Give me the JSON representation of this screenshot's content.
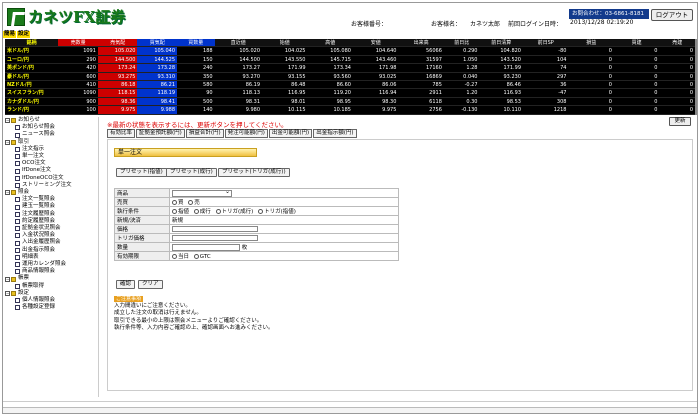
{
  "header": {
    "logo_text": "カネツFX証券",
    "customer_no_label": "お客様番号：",
    "customer_name_label": "お客様名：",
    "customer_name": "カネツ太郎",
    "last_login_label": "前回ログイン日時：",
    "last_login": "2013/12/28 02:19:20",
    "contact": "お問合わせ：03-6861-8181",
    "logout": "ログアウト"
  },
  "small_tabs": [
    "簡易",
    "設定"
  ],
  "ticker": {
    "headers": [
      "銘柄",
      "売数量",
      "売気配",
      "買気配",
      "買数量",
      "直近値",
      "始値",
      "高値",
      "安値",
      "出来高",
      "前日比",
      "前日清算",
      "前日SP",
      "損益",
      "買建",
      "売建"
    ],
    "rows": [
      [
        "米ドル/円",
        "1091",
        "105.020",
        "105.040",
        "188",
        "105.020",
        "104.025",
        "105.080",
        "104.640",
        "56066",
        "0.290",
        "104.820",
        "-80",
        "0",
        "0",
        "0"
      ],
      [
        "ユーロ/円",
        "290",
        "144.500",
        "144.525",
        "150",
        "144.500",
        "143.550",
        "145.715",
        "143.460",
        "31597",
        "1.050",
        "143.520",
        "104",
        "0",
        "0",
        "0"
      ],
      [
        "英ポンド/円",
        "420",
        "173.24",
        "173.28",
        "240",
        "173.27",
        "171.99",
        "173.34",
        "171.98",
        "17160",
        "1.28",
        "171.99",
        "74",
        "0",
        "0",
        "0"
      ],
      [
        "豪ドル/円",
        "600",
        "93.275",
        "93.310",
        "350",
        "93.270",
        "93.155",
        "93.560",
        "93.025",
        "16869",
        "0.040",
        "93.230",
        "297",
        "0",
        "0",
        "0"
      ],
      [
        "NZドル/円",
        "410",
        "86.18",
        "86.21",
        "580",
        "86.19",
        "86.48",
        "86.60",
        "86.06",
        "785",
        "-0.27",
        "86.46",
        "36",
        "0",
        "0",
        "0"
      ],
      [
        "スイスフラン/円",
        "1090",
        "118.15",
        "118.19",
        "90",
        "118.13",
        "116.95",
        "119.20",
        "116.94",
        "2911",
        "1.20",
        "116.93",
        "-47",
        "0",
        "0",
        "0"
      ],
      [
        "カナダドル/円",
        "900",
        "98.36",
        "98.41",
        "500",
        "98.31",
        "98.01",
        "98.95",
        "98.30",
        "6118",
        "0.30",
        "98.53",
        "308",
        "0",
        "0",
        "0"
      ],
      [
        "ランド/円",
        "100",
        "9.975",
        "9.988",
        "140",
        "9.980",
        "10.115",
        "10.185",
        "9.975",
        "2756",
        "-0.130",
        "10.110",
        "1218",
        "0",
        "0",
        "0"
      ]
    ]
  },
  "sidebar": {
    "groups": [
      {
        "label": "お知らせ",
        "items": [
          "お知らせ照会",
          "ニュース照会"
        ]
      },
      {
        "label": "取引",
        "items": [
          "注文指示",
          "単一注文",
          "OCO注文",
          "IfDone注文",
          "IfDoneOCO注文",
          "ストリーミング注文"
        ]
      },
      {
        "label": "照会",
        "items": [
          "注文一覧照会",
          "建玉一覧照会",
          "注文履歴照会",
          "約定履歴照会",
          "証拠金状況照会",
          "入金状況照会",
          "入出金履歴照会",
          "出金指示照会",
          "明細表",
          "運用カレンダ照会",
          "商品情報照会"
        ]
      },
      {
        "label": "帳票",
        "items": [
          "帳票取得"
        ]
      },
      {
        "label": "設定",
        "items": [
          "個人情報照会",
          "各種設定登録"
        ]
      }
    ]
  },
  "main": {
    "notice": "※最新の状態を表示するには、更新ボタンを押してください。",
    "refresh": "更新",
    "subtabs": [
      "有効比率",
      "証拠金預託額(円)",
      "損益合計(円)",
      "発注可能額(円)",
      "出金可能額(円)",
      "出金指示額(円)"
    ],
    "panel_title": "単一注文",
    "presets": [
      "プリセット(指値)",
      "プリセット(成行)",
      "プリセット(トリガ(成行))"
    ],
    "form": {
      "rows": [
        {
          "label": "商品",
          "type": "select",
          "value": ""
        },
        {
          "label": "売買",
          "type": "radio",
          "options": [
            "買",
            "売"
          ]
        },
        {
          "label": "執行条件",
          "type": "radio",
          "options": [
            "指値",
            "成行",
            "トリガ(成行)",
            "トリガ(指値)"
          ]
        },
        {
          "label": "新規/決済",
          "type": "text",
          "value": "新規"
        },
        {
          "label": "価格",
          "type": "input"
        },
        {
          "label": "トリガ価格",
          "type": "input"
        },
        {
          "label": "数量",
          "type": "input-unit",
          "unit": "枚"
        },
        {
          "label": "有効期限",
          "type": "radio",
          "options": [
            "当日",
            "GTC"
          ]
        }
      ]
    },
    "buttons": {
      "confirm": "確認",
      "clear": "クリア"
    },
    "caution": {
      "tag": "ご注意事項",
      "lines": [
        "入力間違いにご注意ください。",
        "成立した注文の取消は行えません。",
        "取引できる最小の上限は照会メニューよりご確認ください。",
        "執行条件等、入力内容ご確認の上、確認画面へお進みください。"
      ]
    }
  }
}
